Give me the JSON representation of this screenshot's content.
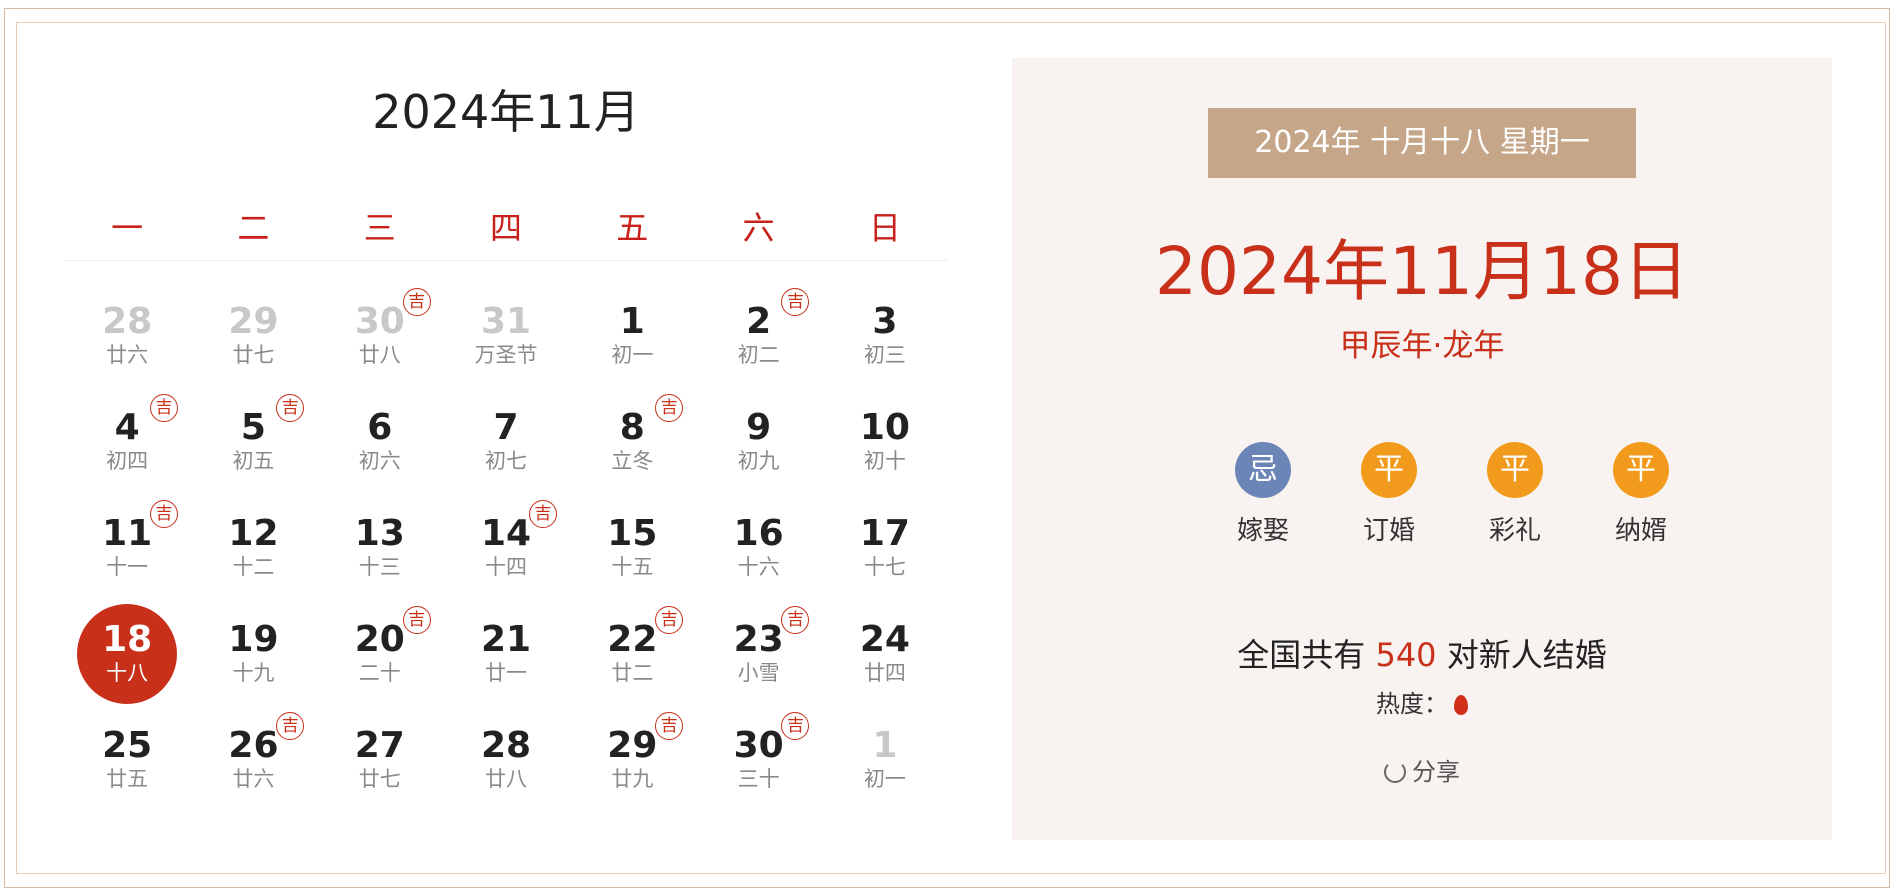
{
  "calendar": {
    "title": "2024年11月",
    "weekdays": [
      "一",
      "二",
      "三",
      "四",
      "五",
      "六",
      "日"
    ],
    "days": [
      {
        "num": "28",
        "lunar": "廿六",
        "other": true,
        "ji": false
      },
      {
        "num": "29",
        "lunar": "廿七",
        "other": true,
        "ji": false
      },
      {
        "num": "30",
        "lunar": "廿八",
        "other": true,
        "ji": true
      },
      {
        "num": "31",
        "lunar": "万圣节",
        "other": true,
        "ji": false
      },
      {
        "num": "1",
        "lunar": "初一",
        "other": false,
        "ji": false
      },
      {
        "num": "2",
        "lunar": "初二",
        "other": false,
        "ji": true
      },
      {
        "num": "3",
        "lunar": "初三",
        "other": false,
        "ji": false
      },
      {
        "num": "4",
        "lunar": "初四",
        "other": false,
        "ji": true
      },
      {
        "num": "5",
        "lunar": "初五",
        "other": false,
        "ji": true
      },
      {
        "num": "6",
        "lunar": "初六",
        "other": false,
        "ji": false
      },
      {
        "num": "7",
        "lunar": "初七",
        "other": false,
        "ji": false
      },
      {
        "num": "8",
        "lunar": "立冬",
        "other": false,
        "ji": true
      },
      {
        "num": "9",
        "lunar": "初九",
        "other": false,
        "ji": false
      },
      {
        "num": "10",
        "lunar": "初十",
        "other": false,
        "ji": false
      },
      {
        "num": "11",
        "lunar": "十一",
        "other": false,
        "ji": true
      },
      {
        "num": "12",
        "lunar": "十二",
        "other": false,
        "ji": false
      },
      {
        "num": "13",
        "lunar": "十三",
        "other": false,
        "ji": false
      },
      {
        "num": "14",
        "lunar": "十四",
        "other": false,
        "ji": true
      },
      {
        "num": "15",
        "lunar": "十五",
        "other": false,
        "ji": false
      },
      {
        "num": "16",
        "lunar": "十六",
        "other": false,
        "ji": false
      },
      {
        "num": "17",
        "lunar": "十七",
        "other": false,
        "ji": false
      },
      {
        "num": "18",
        "lunar": "十八",
        "other": false,
        "ji": false,
        "selected": true
      },
      {
        "num": "19",
        "lunar": "十九",
        "other": false,
        "ji": false
      },
      {
        "num": "20",
        "lunar": "二十",
        "other": false,
        "ji": true
      },
      {
        "num": "21",
        "lunar": "廿一",
        "other": false,
        "ji": false
      },
      {
        "num": "22",
        "lunar": "廿二",
        "other": false,
        "ji": true
      },
      {
        "num": "23",
        "lunar": "小雪",
        "other": false,
        "ji": true
      },
      {
        "num": "24",
        "lunar": "廿四",
        "other": false,
        "ji": false
      },
      {
        "num": "25",
        "lunar": "廿五",
        "other": false,
        "ji": false
      },
      {
        "num": "26",
        "lunar": "廿六",
        "other": false,
        "ji": true
      },
      {
        "num": "27",
        "lunar": "廿七",
        "other": false,
        "ji": false
      },
      {
        "num": "28",
        "lunar": "廿八",
        "other": false,
        "ji": false
      },
      {
        "num": "29",
        "lunar": "廿九",
        "other": false,
        "ji": true
      },
      {
        "num": "30",
        "lunar": "三十",
        "other": false,
        "ji": true
      },
      {
        "num": "1",
        "lunar": "初一",
        "other": true,
        "ji": false
      }
    ],
    "ji_label": "吉"
  },
  "detail": {
    "lunar_line": "2024年  十月十八  星期一",
    "date": "2024年11月18日",
    "ganzhi": "甲辰年·龙年",
    "items": [
      {
        "mark": "忌",
        "label": "嫁娶",
        "kind": "ji"
      },
      {
        "mark": "平",
        "label": "订婚",
        "kind": "ping"
      },
      {
        "mark": "平",
        "label": "彩礼",
        "kind": "ping"
      },
      {
        "mark": "平",
        "label": "纳婿",
        "kind": "ping"
      }
    ],
    "stat_prefix": "全国共有 ",
    "stat_count": "540",
    "stat_suffix": " 对新人结婚",
    "heat_label": "热度：",
    "share_label": "分享"
  },
  "colors": {
    "accent": "#c8301a",
    "tan": "#c5a689",
    "ji_blue": "#6b86b6",
    "ping_orange": "#f29a1b"
  }
}
